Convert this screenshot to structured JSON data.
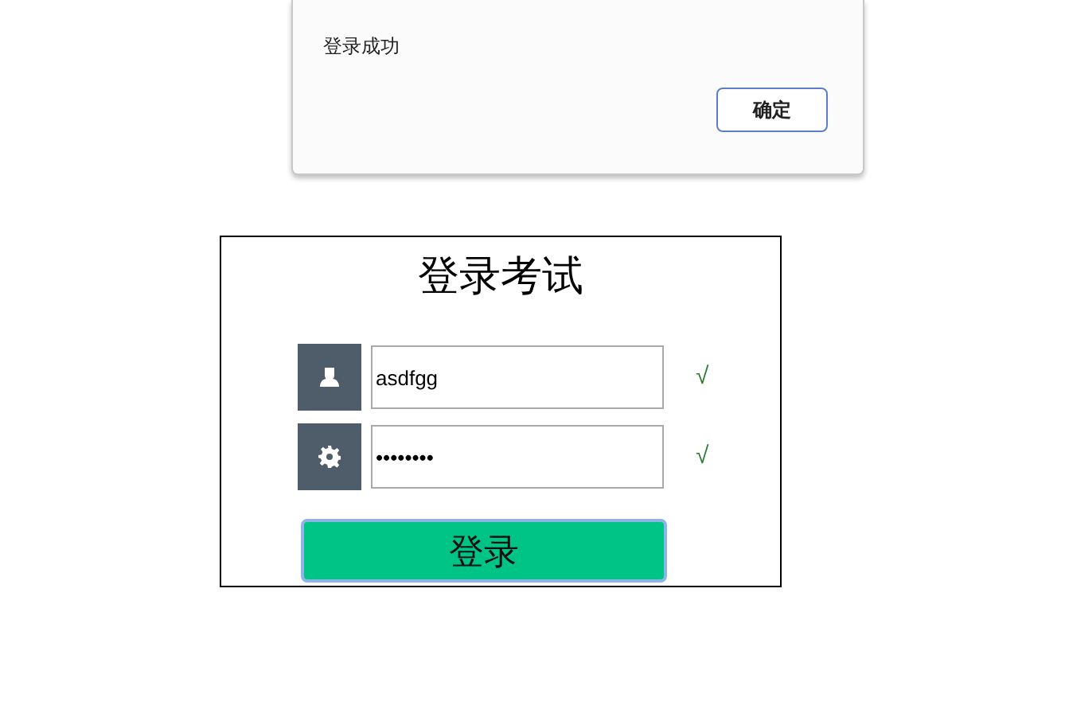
{
  "dialog": {
    "message": "登录成功",
    "button": "确定"
  },
  "login": {
    "title": "登录考试",
    "fields": [
      {
        "kind": "user",
        "value": "asdfgg",
        "mark": "√"
      },
      {
        "kind": "password",
        "value": "••••••••",
        "mark": "√"
      }
    ],
    "submit": "登录"
  }
}
